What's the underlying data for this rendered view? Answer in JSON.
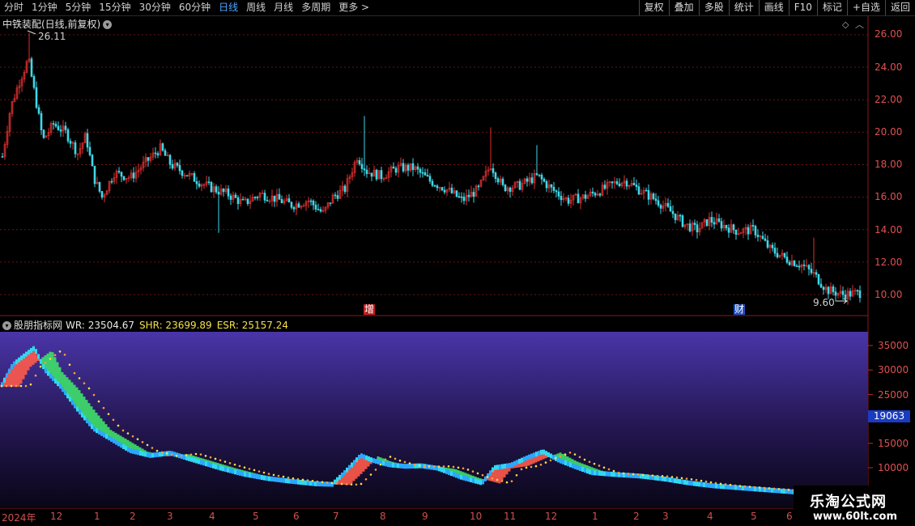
{
  "tabs": [
    {
      "label": "分时",
      "active": false
    },
    {
      "label": "1分钟",
      "active": false
    },
    {
      "label": "5分钟",
      "active": false
    },
    {
      "label": "15分钟",
      "active": false
    },
    {
      "label": "30分钟",
      "active": false
    },
    {
      "label": "60分钟",
      "active": false
    },
    {
      "label": "日线",
      "active": true
    },
    {
      "label": "周线",
      "active": false
    },
    {
      "label": "月线",
      "active": false
    },
    {
      "label": "多周期",
      "active": false
    },
    {
      "label": "更多",
      "active": false
    }
  ],
  "tools": [
    "复权",
    "叠加",
    "多股",
    "统计",
    "画线",
    "F10",
    "标记",
    "+自选",
    "返回"
  ],
  "upper": {
    "title": "中铁装配(日线,前复权)",
    "high_label": "26.11",
    "low_label": "9.60",
    "axis": [
      "26.00",
      "24.00",
      "22.00",
      "20.00",
      "18.00",
      "16.00",
      "14.00",
      "12.00",
      "10.00"
    ],
    "tag_zeng": "增",
    "tag_cai": "财"
  },
  "indicator": {
    "name": "股朋指标网",
    "wr": "WR: 23504.67",
    "shr": "SHR: 23699.89",
    "esr": "ESR: 25157.24",
    "axis": [
      "35000",
      "30000",
      "25000",
      "15000",
      "10000"
    ],
    "current": "19063"
  },
  "dates": [
    "2024年",
    "12",
    "1",
    "2",
    "3",
    "4",
    "5",
    "6",
    "7",
    "8",
    "9",
    "10",
    "11",
    "12",
    "1",
    "2",
    "3",
    "4",
    "5",
    "6"
  ],
  "watermark": {
    "line1": "乐淘公式网",
    "line2": "www.60lt.com"
  },
  "colors": {
    "up": "#e03030",
    "down": "#40d8e8",
    "grid": "#7a1a1a",
    "accent": "#4fa3ff"
  },
  "icons": {
    "tab_more": "chevron-right-icon",
    "title_menu": "chevron-down-circle-icon",
    "indicator_menu": "chevron-down-circle-icon",
    "fav": "diamond-icon",
    "collapse": "chevron-up-icon"
  }
}
